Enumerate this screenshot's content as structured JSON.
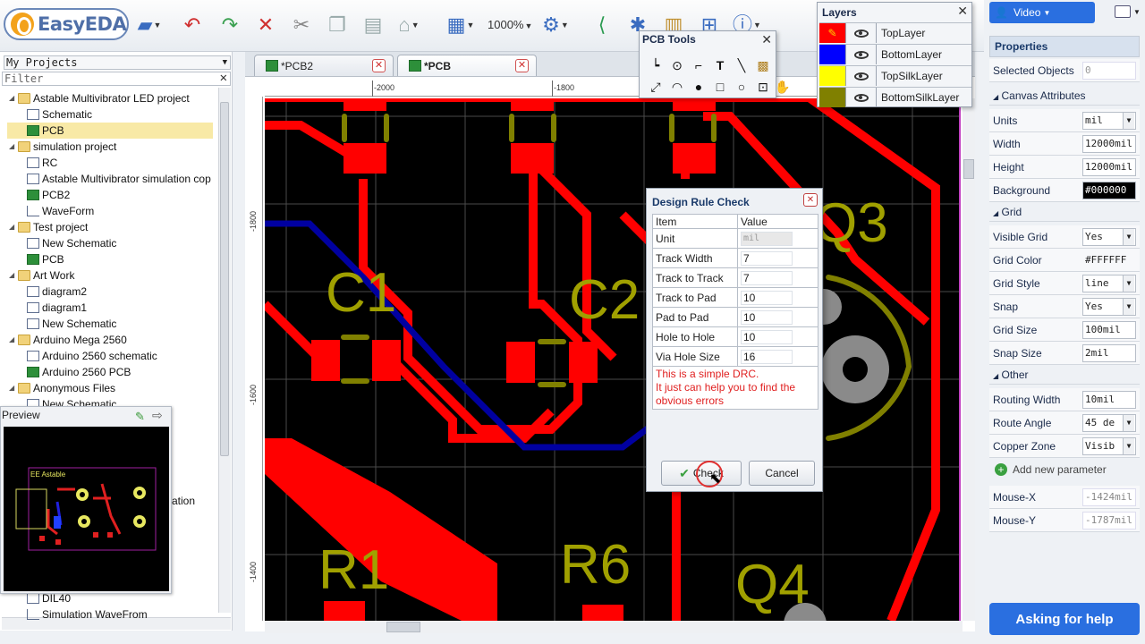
{
  "app": {
    "logo_text": "EasyEDA",
    "zoom": "1000%"
  },
  "toolbar": {
    "icons": [
      "folder-open-icon",
      "undo-icon",
      "redo-icon",
      "delete-icon",
      "cut-icon",
      "copy-icon",
      "paste-icon",
      "brush-icon",
      "align-icon",
      "zoom-dropdown",
      "settings-icon",
      "share-icon",
      "puzzle-icon",
      "bom-icon",
      "cart-icon",
      "info-icon"
    ]
  },
  "projects": {
    "header": "My Projects",
    "filter_placeholder": "Filter",
    "items": [
      {
        "label": "Astable Multivibrator LED project",
        "type": "folder",
        "depth": 0
      },
      {
        "label": "Schematic",
        "type": "sch",
        "depth": 1
      },
      {
        "label": "PCB",
        "type": "pcb",
        "depth": 1,
        "selected": true
      },
      {
        "label": "simulation project",
        "type": "folder",
        "depth": 0
      },
      {
        "label": "RC",
        "type": "sch",
        "depth": 1
      },
      {
        "label": "Astable Multivibrator simulation cop",
        "type": "sch",
        "depth": 1
      },
      {
        "label": "PCB2",
        "type": "pcb",
        "depth": 1
      },
      {
        "label": "WaveForm",
        "type": "wave",
        "depth": 1
      },
      {
        "label": "Test project",
        "type": "folder",
        "depth": 0
      },
      {
        "label": "New Schematic",
        "type": "sch",
        "depth": 1
      },
      {
        "label": "PCB",
        "type": "pcb",
        "depth": 1
      },
      {
        "label": "Art Work",
        "type": "folder",
        "depth": 0
      },
      {
        "label": "diagram2",
        "type": "sch",
        "depth": 1
      },
      {
        "label": "diagram1",
        "type": "sch",
        "depth": 1
      },
      {
        "label": "New Schematic",
        "type": "sch",
        "depth": 1
      },
      {
        "label": "Arduino Mega 2560",
        "type": "folder",
        "depth": 0
      },
      {
        "label": "Arduino 2560 schematic",
        "type": "sch",
        "depth": 1
      },
      {
        "label": "Arduino 2560 PCB",
        "type": "pcb",
        "depth": 1
      },
      {
        "label": "Anonymous Files",
        "type": "folder",
        "depth": 0
      },
      {
        "label": "New Schematic",
        "type": "sch",
        "depth": 1
      }
    ],
    "hidden_partial": [
      "ation",
      "DIL40",
      "Simulation WaveFrom"
    ]
  },
  "preview": {
    "title": "Preview",
    "board_label": "EE Astable"
  },
  "tabs": [
    {
      "label": "*PCB2",
      "active": false
    },
    {
      "label": "*PCB",
      "active": true
    }
  ],
  "ruler": {
    "top": [
      "-2000",
      "-1800"
    ],
    "left": [
      "-1800",
      "-1600",
      "-1400"
    ]
  },
  "pcb_labels": {
    "c1": "C1",
    "c2": "C2",
    "q3": "Q3",
    "q4": "Q4",
    "r1": "R1",
    "r6": "R6"
  },
  "pcb_tools": {
    "title": "PCB Tools"
  },
  "layers": {
    "title": "Layers",
    "items": [
      {
        "name": "TopLayer",
        "color": "#ff0000",
        "active": true
      },
      {
        "name": "BottomLayer",
        "color": "#0000ff"
      },
      {
        "name": "TopSilkLayer",
        "color": "#ffff00"
      },
      {
        "name": "BottomSilkLayer",
        "color": "#808000"
      }
    ]
  },
  "drc": {
    "title": "Design Rule Check",
    "col_item": "Item",
    "col_value": "Value",
    "rows": [
      {
        "item": "Unit",
        "value": "mil",
        "disabled": true
      },
      {
        "item": "Track Width",
        "value": "7"
      },
      {
        "item": "Track to Track",
        "value": "7"
      },
      {
        "item": "Track to Pad",
        "value": "10"
      },
      {
        "item": "Pad to Pad",
        "value": "10"
      },
      {
        "item": "Hole to Hole",
        "value": "10"
      },
      {
        "item": "Via Hole Size",
        "value": "16"
      }
    ],
    "note_line1": "This is a simple DRC.",
    "note_line2": "It just can help you to find the",
    "note_line3": "obvious errors",
    "check_label": "Check",
    "cancel_label": "Cancel"
  },
  "right": {
    "video_label": "Video",
    "properties_title": "Properties",
    "selected_objects_label": "Selected Objects",
    "selected_objects_value": "0",
    "canvas_section": "Canvas Attributes",
    "units_label": "Units",
    "units_value": "mil",
    "width_label": "Width",
    "width_value": "12000mil",
    "height_label": "Height",
    "height_value": "12000mil",
    "background_label": "Background",
    "background_value": "#000000",
    "grid_section": "Grid",
    "visible_grid_label": "Visible Grid",
    "visible_grid_value": "Yes",
    "grid_color_label": "Grid Color",
    "grid_color_value": "#FFFFFF",
    "grid_style_label": "Grid Style",
    "grid_style_value": "line",
    "snap_label": "Snap",
    "snap_value": "Yes",
    "grid_size_label": "Grid Size",
    "grid_size_value": "100mil",
    "snap_size_label": "Snap Size",
    "snap_size_value": "2mil",
    "other_section": "Other",
    "routing_width_label": "Routing Width",
    "routing_width_value": "10mil",
    "route_angle_label": "Route Angle",
    "route_angle_value": "45 de",
    "copper_zone_label": "Copper Zone",
    "copper_zone_value": "Visib",
    "add_param_label": "Add new parameter",
    "mouse_x_label": "Mouse-X",
    "mouse_x_value": "-1424mil",
    "mouse_y_label": "Mouse-Y",
    "mouse_y_value": "-1787mil",
    "help_label": "Asking for help"
  }
}
